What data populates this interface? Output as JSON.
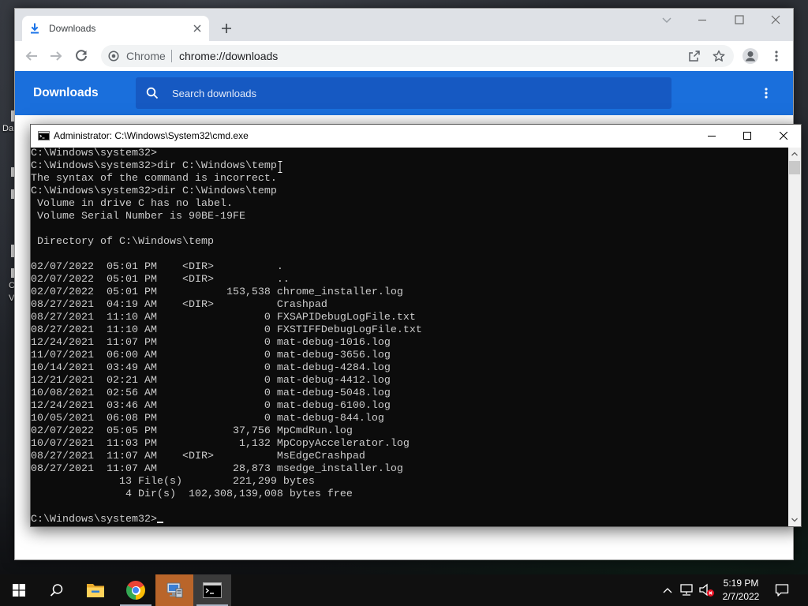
{
  "desktop": {
    "icon_labels": [
      "Da",
      "C",
      "V"
    ]
  },
  "chrome": {
    "tab": {
      "title": "Downloads",
      "icon": "download-icon",
      "close_icon": "close-icon"
    },
    "new_tab_icon": "plus-icon",
    "window_controls": [
      "chevron-down-icon",
      "minimize-icon",
      "maximize-icon",
      "close-icon"
    ],
    "toolbar": {
      "back_icon": "arrow-left-icon",
      "forward_icon": "arrow-right-icon",
      "reload_icon": "reload-icon",
      "site_label": "Chrome",
      "url": "chrome://downloads",
      "share_icon": "share-icon",
      "bookmark_icon": "star-icon",
      "profile_icon": "profile-icon",
      "menu_icon": "more-vert-icon"
    },
    "page": {
      "title": "Downloads",
      "search_placeholder": "Search downloads",
      "search_icon": "search-icon",
      "menu_icon": "more-vert-icon"
    }
  },
  "cmd": {
    "title": "Administrator: C:\\Windows\\System32\\cmd.exe",
    "title_icon": "cmd-icon",
    "window_controls": [
      "minimize-icon",
      "maximize-icon",
      "close-icon"
    ],
    "lines": [
      "C:\\Windows\\system32>",
      "C:\\Windows\\system32>dir C:\\Windows\\temp",
      "The syntax of the command is incorrect.",
      "C:\\Windows\\system32>dir C:\\Windows\\temp",
      " Volume in drive C has no label.",
      " Volume Serial Number is 90BE-19FE",
      "",
      " Directory of C:\\Windows\\temp",
      "",
      "02/07/2022  05:01 PM    <DIR>          .",
      "02/07/2022  05:01 PM    <DIR>          ..",
      "02/07/2022  05:01 PM           153,538 chrome_installer.log",
      "08/27/2021  04:19 AM    <DIR>          Crashpad",
      "08/27/2021  11:10 AM                 0 FXSAPIDebugLogFile.txt",
      "08/27/2021  11:10 AM                 0 FXSTIFFDebugLogFile.txt",
      "12/24/2021  11:07 PM                 0 mat-debug-1016.log",
      "11/07/2021  06:00 AM                 0 mat-debug-3656.log",
      "10/14/2021  03:49 AM                 0 mat-debug-4284.log",
      "12/21/2021  02:21 AM                 0 mat-debug-4412.log",
      "10/08/2021  02:56 AM                 0 mat-debug-5048.log",
      "12/24/2021  03:46 AM                 0 mat-debug-6100.log",
      "10/05/2021  06:08 PM                 0 mat-debug-844.log",
      "02/07/2022  05:05 PM            37,756 MpCmdRun.log",
      "10/07/2021  11:03 PM             1,132 MpCopyAccelerator.log",
      "08/27/2021  11:07 AM    <DIR>          MsEdgeCrashpad",
      "08/27/2021  11:07 AM            28,873 msedge_installer.log",
      "              13 File(s)        221,299 bytes",
      "               4 Dir(s)  102,308,139,008 bytes free",
      "",
      "C:\\Windows\\system32>"
    ]
  },
  "taskbar": {
    "icons": [
      "windows-logo-icon",
      "search-icon",
      "folder-icon",
      "chrome-icon",
      "installer-icon",
      "cmd-icon"
    ],
    "tray_icons": [
      "chevron-up-icon",
      "network-icon",
      "volume-muted-icon",
      "notification-icon"
    ],
    "clock": {
      "time": "5:19 PM",
      "date": "2/7/2022"
    }
  },
  "colors": {
    "chrome_accent": "#1a73e8",
    "downloads_header": "#1a6fdc",
    "downloads_search": "#1659c2",
    "console_background": "#0c0c0c",
    "console_text": "#cccccc",
    "taskbar": "#101010",
    "taskbar_flash": "#b9652a"
  }
}
